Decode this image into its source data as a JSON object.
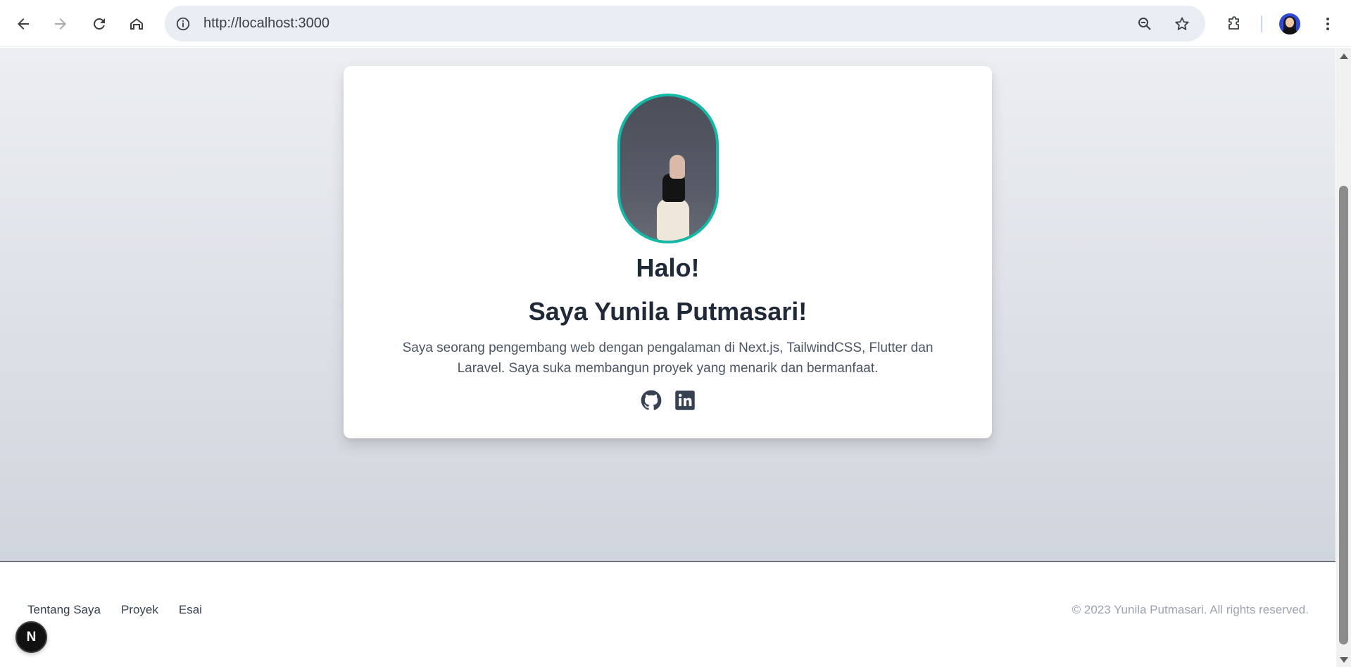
{
  "browser": {
    "url": "http://localhost:3000",
    "icons": {
      "back": "arrow-left-icon",
      "forward": "arrow-right-icon",
      "reload": "reload-icon",
      "home": "home-icon",
      "site_info": "info-icon",
      "zoom": "zoom-out-icon",
      "bookmark": "star-icon",
      "extensions": "puzzle-icon",
      "profile": "avatar-icon",
      "menu": "kebab-menu-icon"
    }
  },
  "hero": {
    "greeting": "Halo!",
    "name_line": "Saya Yunila Putmasari!",
    "bio": "Saya seorang pengembang web dengan pengalaman di Next.js, TailwindCSS, Flutter dan Laravel. Saya suka membangun proyek yang menarik dan bermanfaat.",
    "socials": [
      {
        "icon": "github-icon"
      },
      {
        "icon": "linkedin-icon"
      }
    ],
    "colors": {
      "portrait_border": "#14b8a6",
      "heading": "#1f2937",
      "text": "#4b5563"
    }
  },
  "footer": {
    "links": [
      "Tentang Saya",
      "Proyek",
      "Esai"
    ],
    "copyright": "© 2023 Yunila Putmasari. All rights reserved."
  },
  "dev_badge": {
    "label": "N"
  }
}
